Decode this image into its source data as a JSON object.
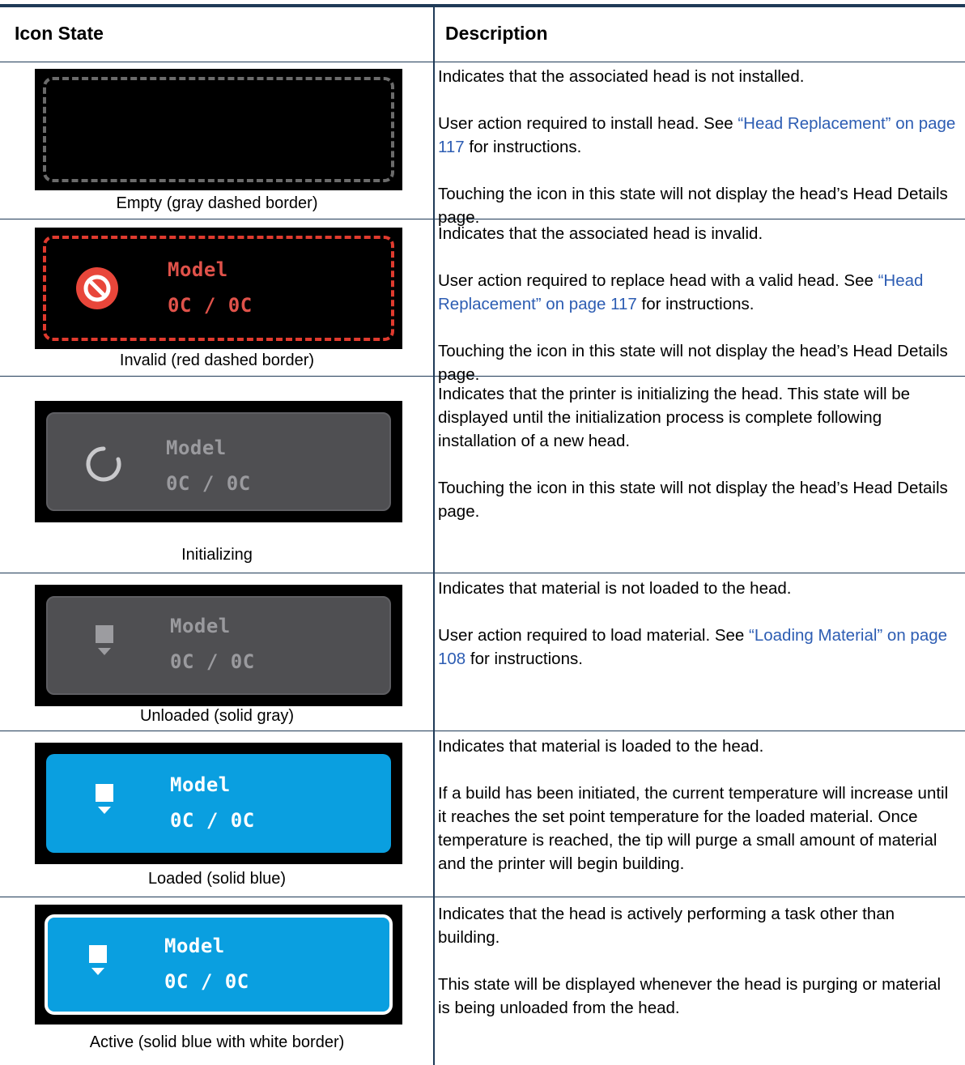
{
  "header": {
    "col1": "Icon State",
    "col2": "Description"
  },
  "rows": [
    {
      "caption": "Empty (gray dashed border)",
      "icon_style": "gray-dashed",
      "p1": "Indicates that the associated head is not installed.",
      "p2_pre": "User action required to install head. See ",
      "p2_link": "“Head Replacement” on page 117",
      "p2_post": " for instructions.",
      "p3": "Touching the icon in this state will not display the head’s Head Details page."
    },
    {
      "caption": "Invalid (red dashed border)",
      "icon_style": "red-dashed",
      "icon_title": "Model",
      "icon_temp": "0C / 0C",
      "icon_glyph": "prohibited-icon",
      "p1": "Indicates that the associated head is invalid.",
      "p2_pre": "User action required to replace head with a valid head. See ",
      "p2_link": "“Head Replacement” on page 117",
      "p2_post": " for instructions.",
      "p3": "Touching the icon in this state will not display the head’s Head Details page."
    },
    {
      "caption": "Initializing",
      "icon_style": "solid-gray",
      "icon_title": "Model",
      "icon_temp": "0C / 0C",
      "icon_glyph": "spinner-icon",
      "p1": "Indicates that the printer is initializing the head. This state will be displayed until the initialization process is complete following installation of a new head.",
      "p2": "Touching the icon in this state will not display the head’s Head Details page."
    },
    {
      "caption": "Unloaded (solid gray)",
      "icon_style": "solid-gray",
      "icon_title": "Model",
      "icon_temp": "0C / 0C",
      "icon_glyph": "nozzle-icon",
      "p1": "Indicates that material is not loaded to the head.",
      "p2_pre": "User action required to load material. See ",
      "p2_link": "“Loading Material” on page 108",
      "p2_post": " for instructions."
    },
    {
      "caption": "Loaded (solid blue)",
      "icon_style": "solid-blue",
      "icon_title": "Model",
      "icon_temp": "0C / 0C",
      "icon_glyph": "nozzle-icon",
      "p1": "Indicates that material is loaded to the head.",
      "p2": "If a build has been initiated, the current temperature will increase until it reaches the set point temperature for the loaded material. Once temperature is reached, the tip will purge a small amount of material and the printer will begin building."
    },
    {
      "caption": "Active (solid blue with white border)",
      "icon_style": "blue-white-border",
      "icon_title": "Model",
      "icon_temp": "0C / 0C",
      "icon_glyph": "nozzle-icon",
      "p1": "Indicates that the head is actively performing a task other than building.",
      "p2": "This state will be displayed whenever the head is purging or material is being unloaded from the head."
    }
  ],
  "colors": {
    "rule": "#1f3a57",
    "link": "#2d5db3",
    "blue_state": "#0a9fe0",
    "red_state": "#e03a2e",
    "gray_state": "#4f4f52"
  }
}
